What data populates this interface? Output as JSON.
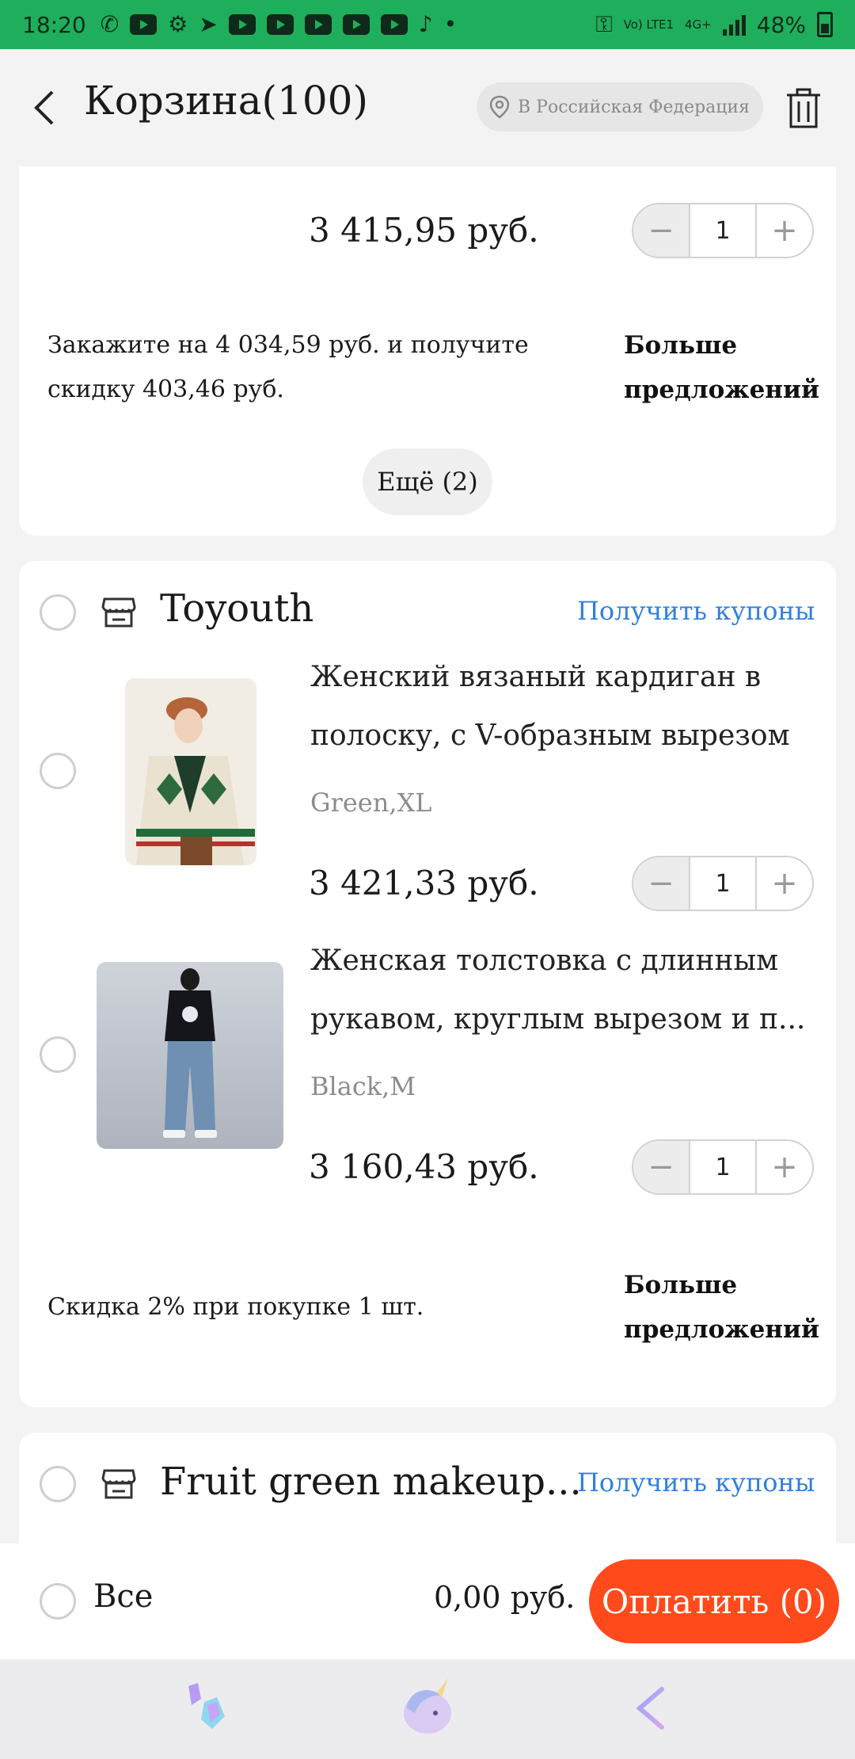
{
  "status_bar": {
    "time": "18:20",
    "network": "Vo) LTE1",
    "net_type": "4G+",
    "battery": "48%"
  },
  "header": {
    "title": "Корзина(100)",
    "region": "В Российская Федерация"
  },
  "card1": {
    "item_price": "3 415,95 руб.",
    "item_qty": "1",
    "promo_line1": "Закажите на 4 034,59 руб. и получите",
    "promo_line2": "скидку 403,46 руб.",
    "more_offers_line1": "Больше",
    "more_offers_line2": "предложений",
    "more_button": "Ещё (2)"
  },
  "card2": {
    "store_name": "Toyouth",
    "coupons": "Получить купоны",
    "products": [
      {
        "title_line1": "Женский вязаный кардиган в",
        "title_line2": "полоску, с V-образным вырезом",
        "variant": "Green,XL",
        "price": "3 421,33 руб.",
        "qty": "1"
      },
      {
        "title_line1": "Женская толстовка с длинным",
        "title_line2": "рукавом, круглым вырезом и п...",
        "variant": "Black,M",
        "price": "3 160,43 руб.",
        "qty": "1"
      }
    ],
    "promo_text": "Скидка 2% при покупке 1 шт.",
    "more_offers_line1": "Больше",
    "more_offers_line2": "предложений"
  },
  "card3": {
    "store_name": "Fruit green makeup...",
    "coupons": "Получить купоны"
  },
  "bottom_bar": {
    "all_label": "Все",
    "total": "0,00 руб.",
    "pay_button": "Оплатить (0)"
  },
  "colors": {
    "status_bar": "#1fae5b",
    "accent_link": "#2f7fe0",
    "pay_button": "#ff4a1c"
  }
}
